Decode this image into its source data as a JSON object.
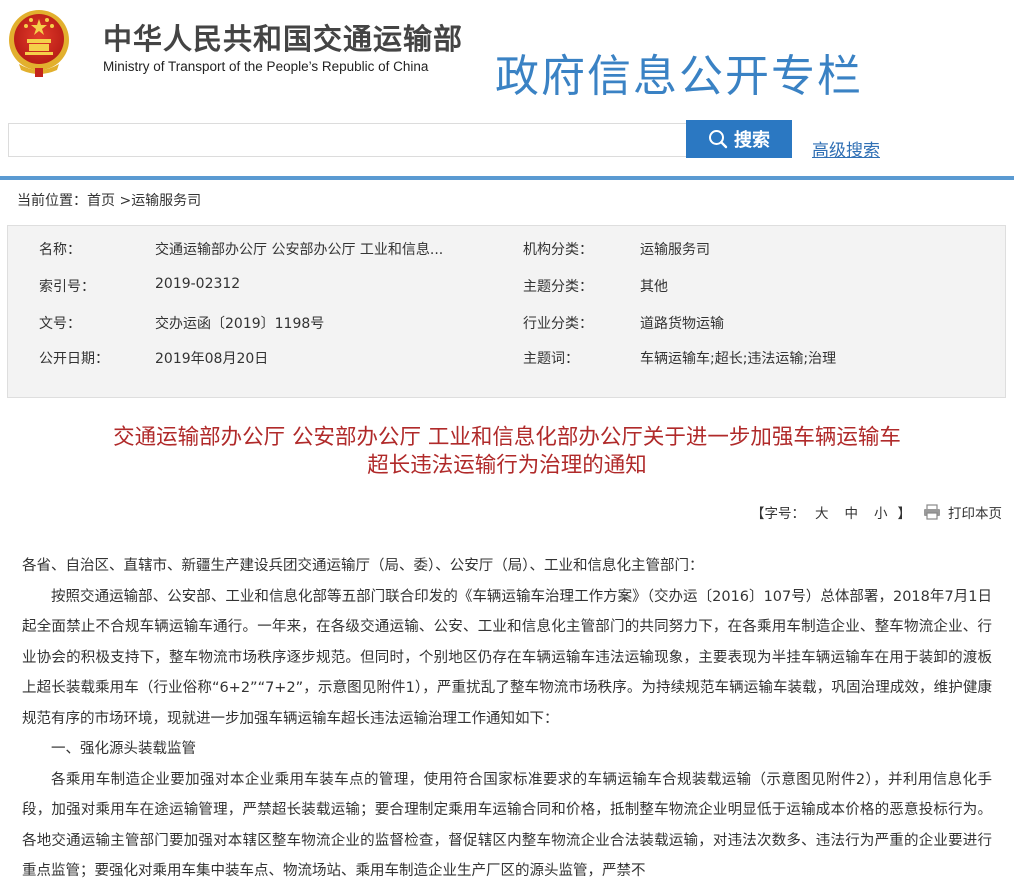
{
  "header": {
    "ministry_cn": "中华人民共和国交通运输部",
    "ministry_en": "Ministry of Transport of the People’s Republic of China",
    "column_title": "政府信息公开专栏"
  },
  "search": {
    "placeholder": "",
    "button_label": "搜索",
    "advanced_label": "高级搜索"
  },
  "breadcrumb": {
    "prefix": "当前位置：",
    "home": "首页",
    "separator": " >",
    "current": "运输服务司"
  },
  "meta": {
    "name_label": "名称：",
    "name_value": "交通运输部办公厅 公安部办公厅 工业和信息...",
    "org_label": "机构分类：",
    "org_value": "运输服务司",
    "index_label": "索引号：",
    "index_value": "2019-02312",
    "topic_label": "主题分类：",
    "topic_value": "其他",
    "docno_label": "文号：",
    "docno_value": "交办运函〔2019〕1198号",
    "industry_label": "行业分类：",
    "industry_value": "道路货物运输",
    "date_label": "公开日期：",
    "date_value": "2019年08月20日",
    "keywords_label": "主题词：",
    "keywords_value": "车辆运输车;超长;违法运输;治理"
  },
  "document": {
    "title_line1": "交通运输部办公厅 公安部办公厅 工业和信息化部办公厅关于进一步加强车辆运输车",
    "title_line2": "超长违法运输行为治理的通知",
    "font_open": "【字号：",
    "size_large": "大",
    "size_medium": "中",
    "size_small": "小",
    "font_close": "】",
    "print_label": "打印本页",
    "paragraphs": [
      "各省、自治区、直辖市、新疆生产建设兵团交通运输厅（局、委）、公安厅（局）、工业和信息化主管部门：",
      "按照交通运输部、公安部、工业和信息化部等五部门联合印发的《车辆运输车治理工作方案》（交办运〔2016〕107号）总体部署，2018年7月1日起全面禁止不合规车辆运输车通行。一年来，在各级交通运输、公安、工业和信息化主管部门的共同努力下，在各乘用车制造企业、整车物流企业、行业协会的积极支持下，整车物流市场秩序逐步规范。但同时，个别地区仍存在车辆运输车违法运输现象，主要表现为半挂车辆运输车在用于装卸的渡板上超长装载乘用车（行业俗称“6+2”“7+2”，示意图见附件1），严重扰乱了整车物流市场秩序。为持续规范车辆运输车装载，巩固治理成效，维护健康规范有序的市场环境，现就进一步加强车辆运输车超长违法运输治理工作通知如下：",
      "一、强化源头装载监管",
      "各乘用车制造企业要加强对本企业乘用车装车点的管理，使用符合国家标准要求的车辆运输车合规装载运输（示意图见附件2），并利用信息化手段，加强对乘用车在途运输管理，严禁超长装载运输；要合理制定乘用车运输合同和价格，抵制整车物流企业明显低于运输成本价格的恶意投标行为。各地交通运输主管部门要加强对本辖区整车物流企业的监督检查，督促辖区内整车物流企业合法装载运输，对违法次数多、违法行为严重的企业要进行重点监管；要强化对乘用车集中装车点、物流场站、乘用车制造企业生产厂区的源头监管，严禁不"
    ]
  }
}
